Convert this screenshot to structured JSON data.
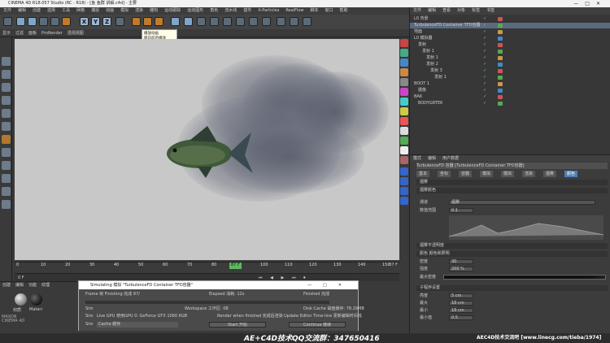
{
  "window": {
    "title": "CINEMA 4D R18.057 Studio (RC - R18) - [鱼 鱼群 讲解.c4d] - 主要"
  },
  "menubar": {
    "items": [
      "文件",
      "编辑",
      "创建",
      "选择",
      "工具",
      "网格",
      "捕捉",
      "动画",
      "模拟",
      "渲染",
      "雕刻",
      "运动跟踪",
      "运动图形",
      "角色",
      "流水线",
      "插件",
      "X-Particles",
      "RealFlow",
      "脚本",
      "窗口",
      "帮助"
    ]
  },
  "toolbar2": {
    "items": [
      "显示",
      "过滤",
      "面板",
      "ProRender",
      "透视视图"
    ]
  },
  "tooltip": {
    "lines": [
      "播放动画",
      "面向前后播放",
      "开始播放 Ctrl+F"
    ]
  },
  "timeline": {
    "ticks": [
      "0",
      "10",
      "20",
      "30",
      "40",
      "50",
      "60",
      "70",
      "80",
      "90",
      "100",
      "110",
      "120",
      "130",
      "140",
      "150"
    ],
    "marker": "87 F",
    "end": "87 F",
    "start": "0 F"
  },
  "material_panel": {
    "menu": [
      "创建",
      "编辑",
      "功能",
      "纹理"
    ],
    "materials": [
      "材质",
      "Materi"
    ]
  },
  "maxon": [
    "MAXON",
    "CINEMA 4D"
  ],
  "sim_window": {
    "title": "Simulating 模拟 \"TurbulenceFD Container TFD容器\"",
    "rows": [
      {
        "label": "Frame 帧 Finishing 完成 87/",
        "mid": "Elapsed 消耗: 12s",
        "right": "Finished 完成"
      },
      {
        "label": "",
        "mid": "",
        "right": ""
      },
      {
        "label": "Sim",
        "mid": "Workspace 工作区: 0B",
        "right": "Disk Cache 磁盘缓存: 78.29MB"
      },
      {
        "label": "Sim",
        "mid": "Live GPU 使用GPU 0: GeForce GTX 1060 6GB",
        "right": "Render when finished 完成后渲染"
      },
      {
        "label": "Sim",
        "mid": "Cache 缓存",
        "right": ""
      }
    ],
    "update_label": "Update Editor Time-line 更新编辑时间线",
    "start_button": "Start 开始",
    "continue_button": "Continue 继续"
  },
  "object_panel": {
    "menu": [
      "文件",
      "编辑",
      "查看",
      "对象",
      "标签",
      "书签"
    ],
    "items": [
      {
        "label": "L0 背景",
        "indent": 1
      },
      {
        "label": "TurbulenceFD Container TFD容器",
        "indent": 1,
        "selected": true
      },
      {
        "label": "地面",
        "indent": 1
      },
      {
        "label": "L0 模拟器",
        "indent": 1
      },
      {
        "label": "发射",
        "indent": 2
      },
      {
        "label": "发射 1",
        "indent": 3
      },
      {
        "label": "发射 1",
        "indent": 4
      },
      {
        "label": "发射 2",
        "indent": 4
      },
      {
        "label": "发射 3",
        "indent": 5
      },
      {
        "label": "发射 1",
        "indent": 6
      },
      {
        "label": "BOOT 1",
        "indent": 1
      },
      {
        "label": "摄像",
        "indent": 2
      },
      {
        "label": "BAK",
        "indent": 1
      },
      {
        "label": "BODYGRTEK",
        "indent": 2
      }
    ]
  },
  "attr_panel": {
    "menu": [
      "模式",
      "编辑",
      "用户数据"
    ],
    "object_title": "TurbulenceFD 容器 [TurbulenceFD Container TFD容器]",
    "tabs": [
      "基本",
      "坐标",
      "容器",
      "模拟",
      "模拟",
      "渲染",
      "烟雾",
      "颜色"
    ],
    "sections": [
      "烟雾",
      "烟雾颜色",
      "烟雾不透明度",
      "颜色 颜色和照明"
    ],
    "rows": [
      {
        "k": "通道",
        "v": "烟雾"
      },
      {
        "k": "数值范围",
        "v": "0.1"
      },
      {
        "k": "密度",
        "v": "30"
      },
      {
        "k": "强度",
        "v": "200 %"
      },
      {
        "k": "最大密度",
        "v": ""
      },
      {
        "k": "亮度",
        "v": "5 cm"
      },
      {
        "k": "最大",
        "v": "18 cm"
      },
      {
        "k": "最小",
        "v": "18 cm"
      },
      {
        "k": "最小值",
        "v": "0.5"
      }
    ],
    "subsections": [
      "子程序设置"
    ]
  },
  "watermark": {
    "left": "AE+C4D技术QQ交流群：347650416",
    "right": "AEC4D技术交流吧 [www.linecg.com/tieba/1974]"
  },
  "colors": {
    "accent": "#4d7fb3",
    "viewport": "#c8c8c8",
    "panel": "#3a3a3a"
  }
}
